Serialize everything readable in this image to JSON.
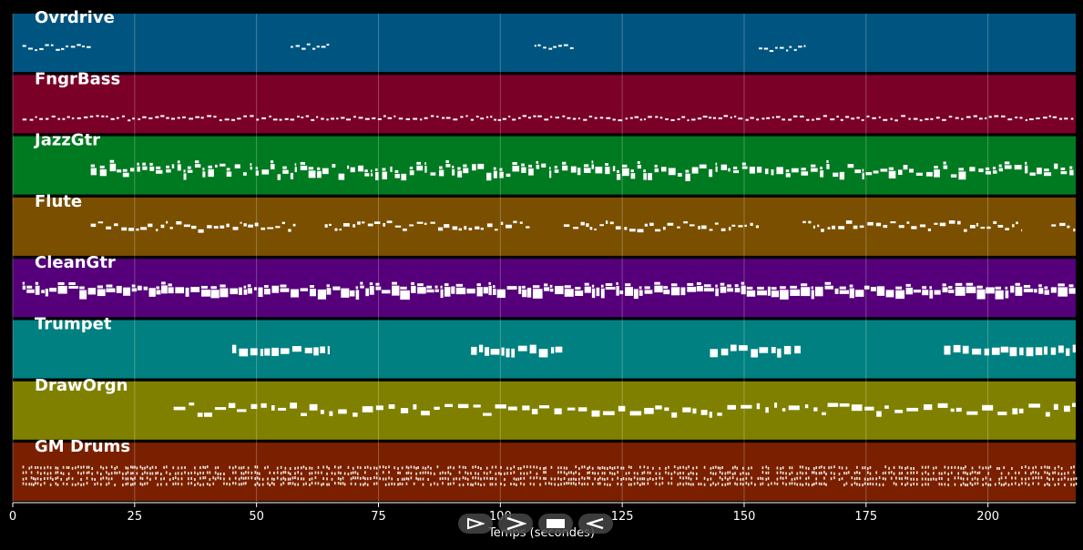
{
  "chart_data": {
    "type": "piano-roll",
    "xlabel": "Temps (secondes)",
    "xlim": [
      0,
      218
    ],
    "xticks": [
      0,
      25,
      50,
      75,
      100,
      125,
      150,
      175,
      200
    ],
    "tracks": [
      {
        "name": "Ovrdrive",
        "color": "#005580",
        "regions": [
          [
            2,
            16
          ],
          [
            57,
            65
          ],
          [
            107,
            115
          ],
          [
            153,
            163
          ]
        ],
        "pattern": "sparse"
      },
      {
        "name": "FngrBass",
        "color": "#7a0028",
        "regions": [
          [
            2,
            218
          ]
        ],
        "pattern": "line"
      },
      {
        "name": "JazzGtr",
        "color": "#007a20",
        "regions": [
          [
            16,
            218
          ]
        ],
        "pattern": "chords"
      },
      {
        "name": "Flute",
        "color": "#7a4f00",
        "regions": [
          [
            16,
            58
          ],
          [
            64,
            106
          ],
          [
            113,
            153
          ],
          [
            162,
            207
          ],
          [
            213,
            218
          ]
        ],
        "pattern": "melody"
      },
      {
        "name": "CleanGtr",
        "color": "#55007a",
        "regions": [
          [
            2,
            218
          ]
        ],
        "pattern": "dense"
      },
      {
        "name": "Trumpet",
        "color": "#008080",
        "regions": [
          [
            45,
            65
          ],
          [
            94,
            113
          ],
          [
            143,
            162
          ],
          [
            191,
            218
          ]
        ],
        "pattern": "blocks"
      },
      {
        "name": "DrawOrgn",
        "color": "#808000",
        "regions": [
          [
            33,
            218
          ]
        ],
        "pattern": "organ"
      },
      {
        "name": "GM Drums",
        "color": "#7a2000",
        "regions": [
          [
            2,
            218
          ]
        ],
        "pattern": "drums"
      }
    ]
  },
  "controls": {
    "play_icon": "play-outline-icon",
    "next_icon": "chevron-right-icon",
    "stop_icon": "stop-icon",
    "back_icon": "rewind-icon"
  }
}
